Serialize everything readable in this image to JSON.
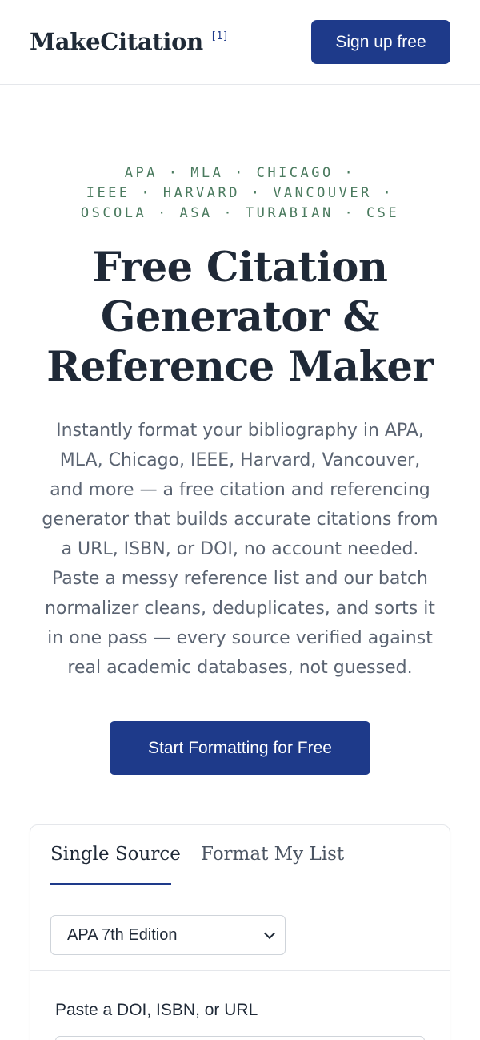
{
  "header": {
    "logo": "MakeCitation",
    "logo_superscript": "[1]",
    "signup_label": "Sign up free"
  },
  "hero": {
    "formats": [
      "APA · MLA · CHICAGO ·",
      "IEEE · HARVARD · VANCOUVER ·",
      "OSCOLA · ASA · TURABIAN · CSE"
    ],
    "title_lines": [
      "Free Citation",
      "Generator &",
      "Reference Maker"
    ],
    "description_lines": [
      "Instantly format your bibliography in APA,",
      "MLA, Chicago, IEEE, Harvard, Vancouver,",
      "and more — a free citation and referencing",
      "generator that builds accurate citations from",
      "a URL, ISBN, or DOI, no account needed.",
      "Paste a messy reference list and our batch",
      "normalizer cleans, deduplicates, and sorts it",
      "in one pass — every source verified against",
      "real academic databases, not guessed."
    ],
    "cta_label": "Start Formatting for Free"
  },
  "tool": {
    "tabs": [
      {
        "label": "Single Source",
        "active": true
      },
      {
        "label": "Format My List",
        "active": false
      }
    ],
    "style_select": {
      "selected": "APA 7th Edition"
    },
    "field_label": "Paste a DOI, ISBN, or URL",
    "field_value": ""
  },
  "colors": {
    "brand": "#1e3a8a",
    "format_tags": "#4a7a5e",
    "heading": "#1f2937",
    "body_text": "#5b6472"
  }
}
